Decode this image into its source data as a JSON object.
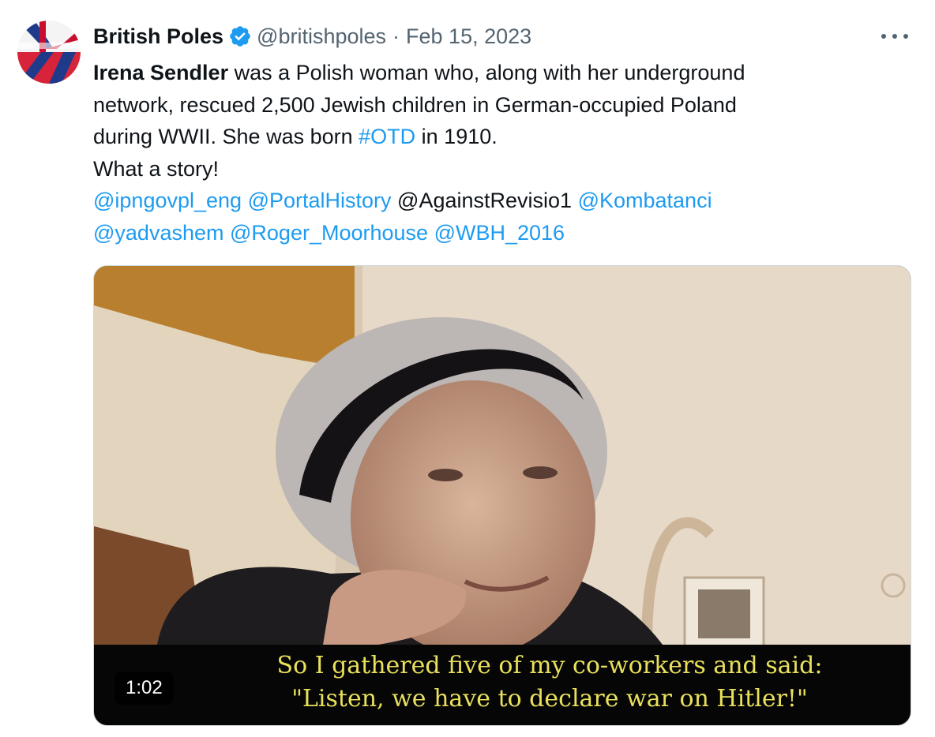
{
  "tweet": {
    "author_name": "British Poles",
    "handle": "@britishpoles",
    "separator": "·",
    "date": "Feb 15, 2023",
    "text": {
      "bold_name": "Irena Sendler",
      "line1_rest": " was a Polish woman who, along with her underground",
      "line2": "network, rescued 2,500 Jewish children in German-occupied Poland",
      "line3_before": "during WWII. She was born ",
      "hashtag": "#OTD",
      "line3_after": " in 1910.",
      "line4": "What a story!"
    },
    "mentions_line1": [
      "@ipngovpl_eng",
      "@PortalHistory"
    ],
    "plain_mention": "@AgainstRevisio1",
    "mention_after_plain": "@Kombatanci",
    "mentions_line2": [
      "@yadvashem",
      "@Roger_Moorhouse",
      "@WBH_2016"
    ]
  },
  "media": {
    "duration": "1:02",
    "subtitle_line1": "So I gathered five of my co-workers and said:",
    "subtitle_line2": "\"Listen, we have to declare war on Hitler!\""
  },
  "icons": {
    "verified": "verified-badge-icon",
    "more": "more-options-icon",
    "avatar": "union-jack-poland-flag-avatar"
  },
  "colors": {
    "link": "#1d9bf0",
    "secondary_text": "#536471",
    "verified": "#1d9bf0",
    "subtitle": "#e9e15c"
  }
}
